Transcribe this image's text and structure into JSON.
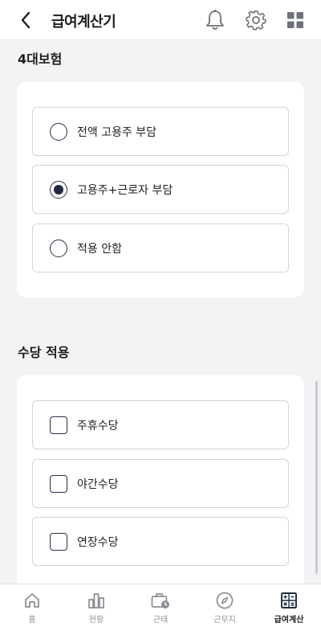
{
  "header": {
    "title": "급여계산기",
    "icons": [
      "back-arrow-icon",
      "bell-icon",
      "gear-icon",
      "grid-icon"
    ]
  },
  "insurance": {
    "title": "4대보험",
    "options": [
      {
        "label": "전액 고용주 부담",
        "selected": false
      },
      {
        "label": "고용주+근로자 부담",
        "selected": true
      },
      {
        "label": "적용 안함",
        "selected": false
      }
    ]
  },
  "allowance": {
    "title": "수당 적용",
    "options": [
      {
        "label": "주휴수당",
        "checked": false
      },
      {
        "label": "야간수당",
        "checked": false
      },
      {
        "label": "연장수당",
        "checked": false
      }
    ]
  },
  "tabbar": {
    "tabs": [
      {
        "label": "홈",
        "icon": "home-icon",
        "active": false
      },
      {
        "label": "현황",
        "icon": "bar-chart-icon",
        "active": false
      },
      {
        "label": "근태",
        "icon": "briefcase-clock-icon",
        "active": false
      },
      {
        "label": "근무지",
        "icon": "compass-icon",
        "active": false
      },
      {
        "label": "급여계산",
        "icon": "calculator-icon",
        "active": true
      }
    ]
  },
  "colors": {
    "accent": "#1f2941",
    "background": "#f2f3f5",
    "inactive": "#8b8e95"
  }
}
